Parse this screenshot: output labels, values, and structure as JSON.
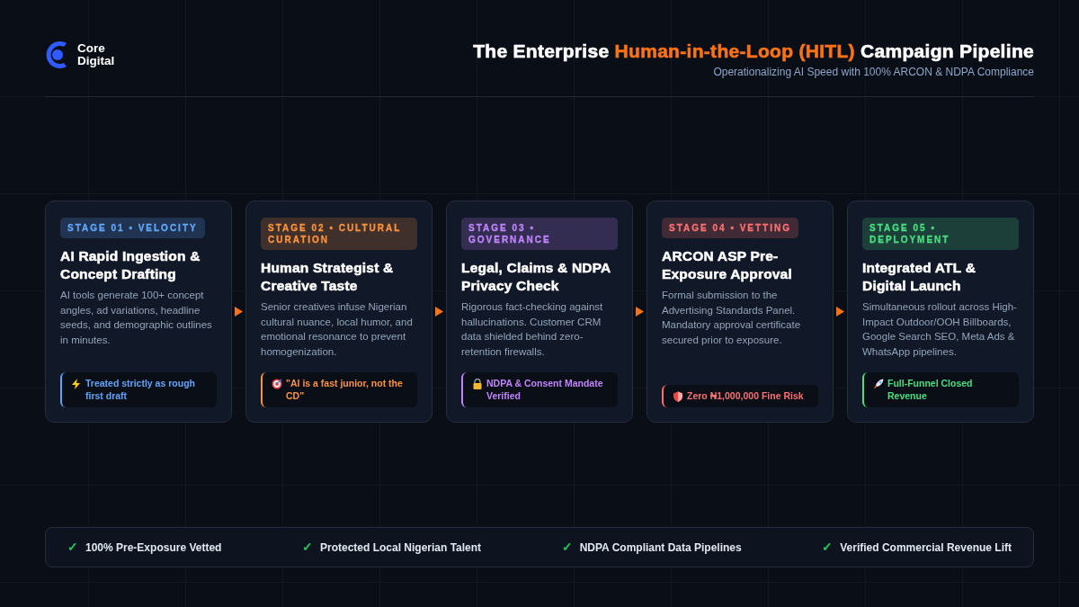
{
  "brand": {
    "line1": "Core",
    "line2": "Digital"
  },
  "header": {
    "title_before": "The Enterprise ",
    "title_highlight": "Human-in-the-Loop (HITL)",
    "title_after": " Campaign Pipeline",
    "subtitle": "Operationalizing AI Speed with 100% ARCON & NDPA Compliance"
  },
  "stages": [
    {
      "badge": "STAGE 01 • VELOCITY",
      "color": "#60a5fa",
      "title": "AI Rapid Ingestion & Concept Drafting",
      "text": "AI tools generate 100+ concept angles, ad variations, headline seeds, and demographic outlines in minutes.",
      "callout": {
        "text": "Treated strictly as rough first draft"
      }
    },
    {
      "badge": "STAGE 02 • CULTURAL CURATION",
      "color": "#fb923c",
      "title": "Human Strategist & Creative Taste",
      "text": "Senior creatives infuse Nigerian cultural nuance, local humor, and emotional resonance to prevent homogenization.",
      "callout": {
        "text": "\"AI is a fast junior, not the CD\""
      }
    },
    {
      "badge": "STAGE 03 • GOVERNANCE",
      "color": "#c084fc",
      "title": "Legal, Claims & NDPA Privacy Check",
      "text": "Rigorous fact-checking against hallucinations. Customer CRM data shielded behind zero-retention firewalls.",
      "callout": {
        "text": "NDPA & Consent Mandate Verified"
      }
    },
    {
      "badge": "STAGE 04 • VETTING",
      "color": "#f87171",
      "title": "ARCON ASP Pre-Exposure Approval",
      "text": "Formal submission to the Advertising Standards Panel. Mandatory approval certificate secured prior to exposure.",
      "callout": {
        "text": "Zero ₦1,000,000 Fine Risk"
      }
    },
    {
      "badge": "STAGE 05 • DEPLOYMENT",
      "color": "#4ade80",
      "title": "Integrated ATL & Digital Launch",
      "text": "Simultaneous rollout across High-Impact Outdoor/OOH Billboards, Google Search SEO, Meta Ads & WhatsApp pipelines.",
      "callout": {
        "text": "Full-Funnel Closed Revenue"
      }
    }
  ],
  "footer": [
    {
      "mark": "✓",
      "text": "100% Pre-Exposure Vetted"
    },
    {
      "mark": "✓",
      "text": "Protected Local Nigerian Talent"
    },
    {
      "mark": "✓",
      "text": "NDPA Compliant Data Pipelines"
    },
    {
      "mark": "✓",
      "text": "Verified Commercial Revenue Lift"
    }
  ]
}
